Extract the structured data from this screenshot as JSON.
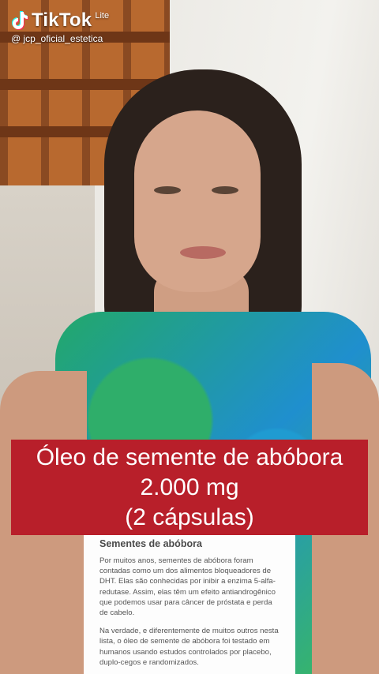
{
  "watermark": {
    "brand": "TikTok",
    "edition": "Lite",
    "handle": "@ jcp_oficial_estetica"
  },
  "caption": {
    "line1": "Óleo de semente de abóbora",
    "line2": "2.000 mg",
    "line3": "(2 cápsulas)"
  },
  "article": {
    "title": "Sementes de abóbora",
    "paragraph1": "Por muitos anos, sementes de abóbora foram contadas como um dos alimentos bloqueadores de DHT. Elas são conhecidas por inibir a enzima 5-alfa-redutase. Assim, elas têm um efeito antiandrogênico que podemos usar para câncer de próstata e perda de cabelo.",
    "paragraph2": "Na verdade, e diferentemente de muitos outros nesta lista, o óleo de semente de abóbora foi testado em humanos usando estudos controlados por placebo, duplo-cegos e randomizados."
  },
  "colors": {
    "caption_bg": "#b81f2a",
    "caption_text": "#ffffff",
    "article_bg": "#fdfdfd"
  },
  "icons": {
    "watermark_logo": "tiktok-logo-icon"
  }
}
